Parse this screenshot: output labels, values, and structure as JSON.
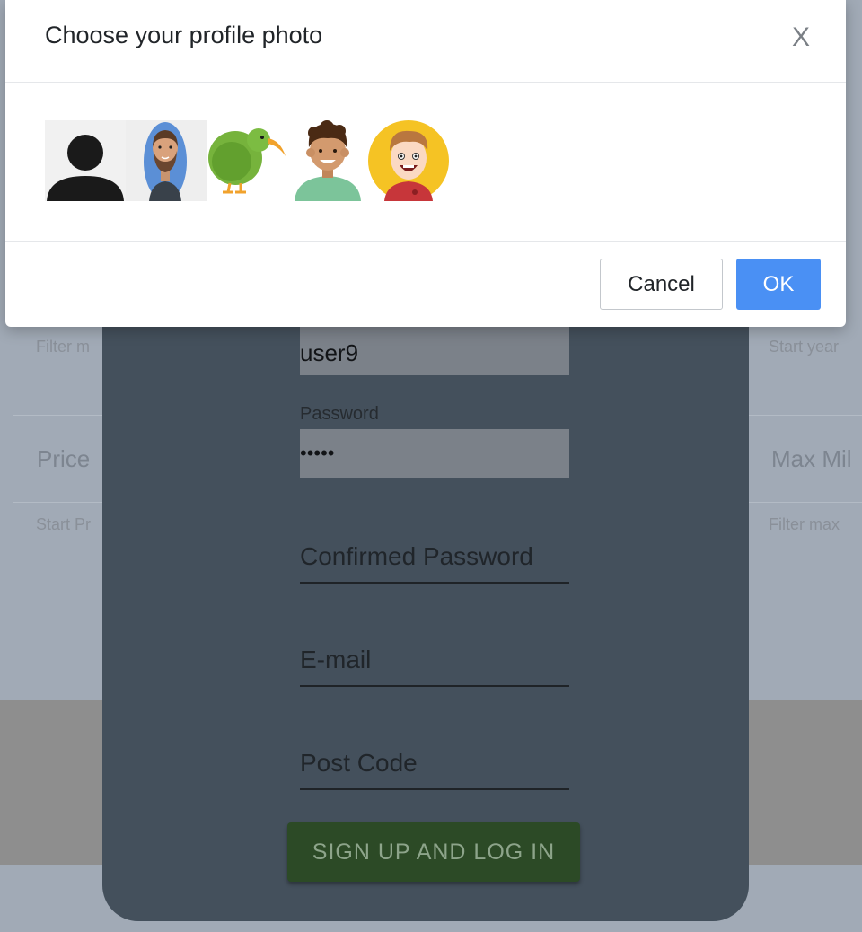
{
  "background": {
    "hint_filter_left": "Filter m",
    "hint_start_year": "Start year",
    "field_price": "Price",
    "field_max_mileage": "Max Mil",
    "hint_start_price": "Start Pr",
    "hint_filter_max": "Filter max"
  },
  "signup": {
    "username_value": "user9",
    "password_label": "Password",
    "password_value": "•••••",
    "confirm_password_placeholder": "Confirmed Password",
    "email_placeholder": "E-mail",
    "postcode_placeholder": "Post Code",
    "submit_label": "SIGN UP AND LOG IN"
  },
  "modal": {
    "title": "Choose your profile photo",
    "close_label": "X",
    "photos": [
      {
        "name": "default-silhouette"
      },
      {
        "name": "bearded-man-avatar"
      },
      {
        "name": "kiwi-bird-avatar"
      },
      {
        "name": "curly-hair-boy-avatar"
      },
      {
        "name": "cartoon-boy-yellow-avatar"
      }
    ],
    "cancel_label": "Cancel",
    "ok_label": "OK"
  },
  "colors": {
    "ok_button": "#4a90f4",
    "card": "#44505c",
    "signup_button": "#2c4a26"
  }
}
